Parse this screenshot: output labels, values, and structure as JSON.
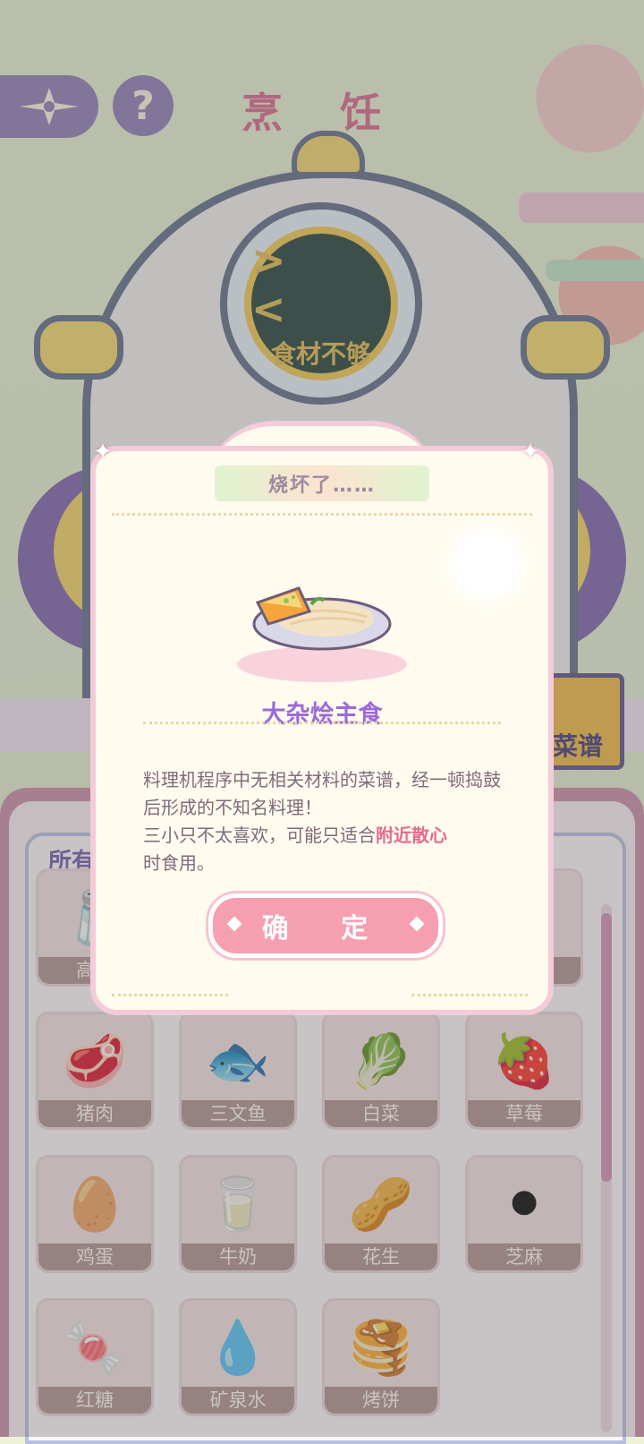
{
  "screen": {
    "title": "烹 饪",
    "robot_face": "> <",
    "robot_message": "食材不够",
    "recipe_button": "菜谱",
    "inventory_header": "所有",
    "help_glyph": "?"
  },
  "inventory": [
    {
      "name": "高筋",
      "icon": "flour-icon",
      "emoji": "🧂"
    },
    {
      "name": "",
      "icon": "hidden-item-icon",
      "emoji": ""
    },
    {
      "name": "",
      "icon": "hidden-item-icon",
      "emoji": ""
    },
    {
      "name": "",
      "icon": "hidden-item-icon",
      "emoji": ""
    },
    {
      "name": "猪肉",
      "icon": "pork-icon",
      "emoji": "🥩"
    },
    {
      "name": "三文鱼",
      "icon": "salmon-icon",
      "emoji": "🐟"
    },
    {
      "name": "白菜",
      "icon": "cabbage-icon",
      "emoji": "🥬"
    },
    {
      "name": "草莓",
      "icon": "strawberry-icon",
      "emoji": "🍓"
    },
    {
      "name": "鸡蛋",
      "icon": "eggs-icon",
      "emoji": "🥚"
    },
    {
      "name": "牛奶",
      "icon": "milk-icon",
      "emoji": "🥛"
    },
    {
      "name": "花生",
      "icon": "peanut-icon",
      "emoji": "🥜"
    },
    {
      "name": "芝麻",
      "icon": "sesame-icon",
      "emoji": "⚫"
    },
    {
      "name": "红糖",
      "icon": "brown-sugar-icon",
      "emoji": "🍬"
    },
    {
      "name": "矿泉水",
      "icon": "water-bottle-icon",
      "emoji": "💧"
    },
    {
      "name": "烤饼",
      "icon": "pancake-icon",
      "emoji": "🥞"
    }
  ],
  "dialog": {
    "title": "烧坏了……",
    "dish_name": "大杂烩主食",
    "description_part1": "料理机程序中无相关材料的菜谱，经一顿捣鼓后形成的不知名料理！",
    "description_part2": "三小只不太喜欢，可能只适合",
    "description_highlight": "附近散心",
    "description_part3": "时食用。",
    "confirm_label": "确 定"
  },
  "colors": {
    "accent_pink": "#f59fb0",
    "title_pink": "#d7668a",
    "dish_purple": "#9b6ad8",
    "highlight": "#e46b8e"
  }
}
